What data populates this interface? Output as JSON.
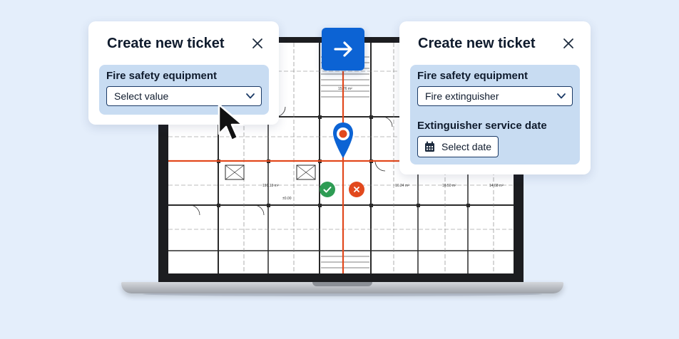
{
  "left_card": {
    "title": "Create new ticket",
    "field_label": "Fire safety equipment",
    "select_value": "Select value"
  },
  "right_card": {
    "title": "Create new ticket",
    "field_label": "Fire safety equipment",
    "select_value": "Fire extinguisher",
    "date_label": "Extinguisher service date",
    "date_button": "Select date"
  },
  "floorplan": {
    "room_labels": [
      "15.76 m²",
      "191.13 m²",
      "16.24 m²",
      "16.50 m²",
      "14.68 m²",
      "±0.00"
    ]
  },
  "icons": [
    "close-icon",
    "chevron-down-icon",
    "calendar-icon",
    "arrow-right-icon",
    "map-pin-icon",
    "check-icon",
    "cancel-icon",
    "cursor-icon"
  ],
  "colors": {
    "background": "#e4eefb",
    "accent_blue": "#0c63d4",
    "route_orange": "#e2491d",
    "confirm_green": "#2e9c54",
    "field_panel": "#c8dcf2",
    "text_dark": "#0f1b2d"
  }
}
